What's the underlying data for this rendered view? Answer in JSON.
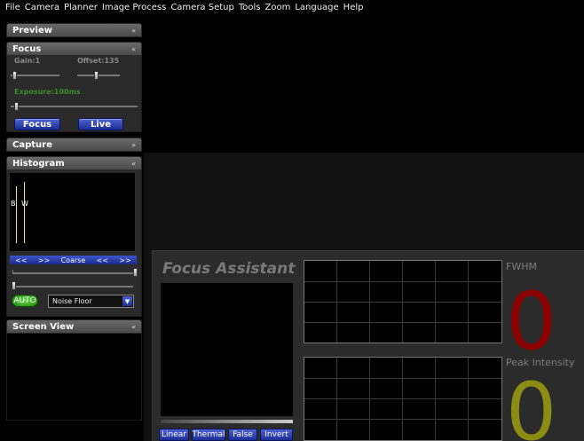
{
  "menu": [
    "File",
    "Camera",
    "Planner",
    "Image Process",
    "Camera Setup",
    "Tools",
    "Zoom",
    "Language",
    "Help"
  ],
  "panels": {
    "preview": {
      "title": "Preview",
      "chevron": "»"
    },
    "focus": {
      "title": "Focus",
      "chevron": "«",
      "gain_label": "Gain:1",
      "offset_label": "Offset:135",
      "exposure_label": "Exposure:100ms",
      "focus_button": "Focus",
      "live_button": "Live",
      "gain_value": 1,
      "offset_value": 135,
      "exposure_ms": 100
    },
    "capture": {
      "title": "Capture",
      "chevron": "»"
    },
    "histogram": {
      "title": "Histogram",
      "chevron": "«",
      "b_marker": "B",
      "w_marker": "W",
      "nav": [
        "<<",
        ">>",
        "Coarse",
        "<<",
        ">>"
      ],
      "auto_button": "AUTO",
      "noise_select": "Noise Floor",
      "dropdown_arrow": "▼"
    },
    "screen_view": {
      "title": "Screen View",
      "chevron": "«"
    }
  },
  "focus_assistant": {
    "title": "Focus Assistant",
    "fwhm_label": "FWHM",
    "fwhm_value": "0",
    "peak_label": "Peak Intensity",
    "peak_value": "0",
    "buttons": [
      "Linear",
      "Thermal",
      "False",
      "Invert"
    ]
  },
  "colors": {
    "accent_blue": "#2a3cb0",
    "fwhm_red": "#8b0000",
    "peak_olive": "#8c8c14",
    "green_label": "#3c8c2c"
  }
}
